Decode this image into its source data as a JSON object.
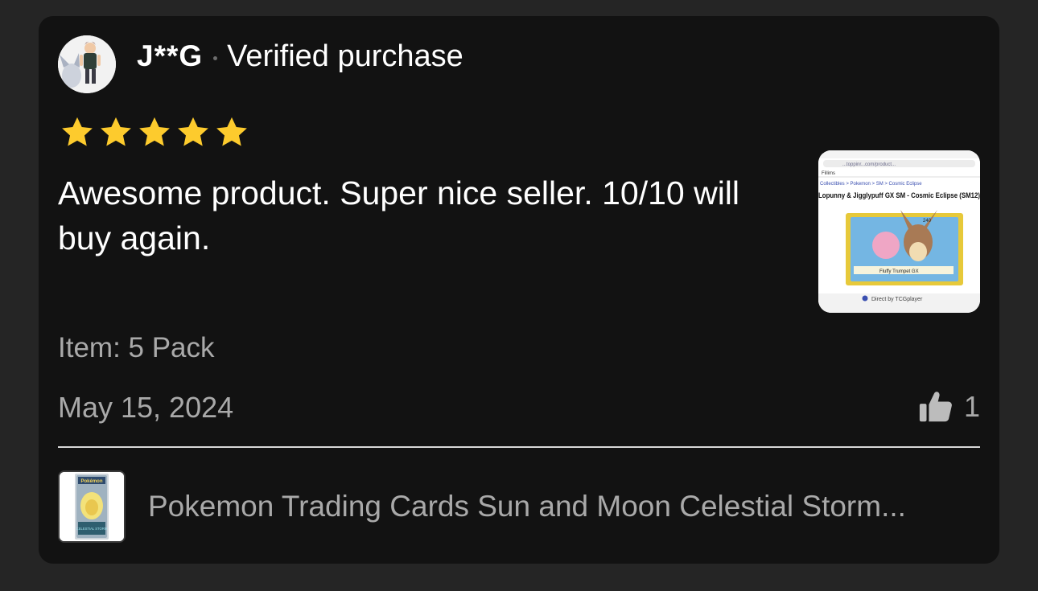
{
  "review": {
    "reviewer_name": "J**G",
    "verified_label": "Verified purchase",
    "rating": 5,
    "rating_max": 5,
    "text": "Awesome product. Super nice seller. 10/10 will buy again.",
    "item_label": "Item: 5 Pack",
    "date": "May 15, 2024",
    "helpful_count": "1",
    "photo_text": {
      "url": "...toppinr...com/product...",
      "brand": "Fillims",
      "breadcrumb": "Collectibles > Pokemon > SM > Cosmic Eclipse",
      "title": "Lopunny & Jigglypuff GX SM - Cosmic Eclipse (SM12)",
      "card_hp": "240",
      "card_ability": "Fluffy Trumpet GX",
      "footer": "Direct by TCGplayer"
    }
  },
  "product": {
    "title": "Pokemon Trading Cards Sun and Moon Celestial Storm...",
    "pack_brand": "Pokémon",
    "pack_set": "CELESTIAL STORM"
  },
  "colors": {
    "page_background": "#252525",
    "card_background": "#121212",
    "star": "#FDCB2D",
    "primary_text": "#FFFFFF",
    "secondary_text": "#A9A9A9",
    "divider": "#D8D8D8"
  },
  "icons": {
    "star": "star-icon",
    "helpful": "thumbs-up-icon"
  }
}
